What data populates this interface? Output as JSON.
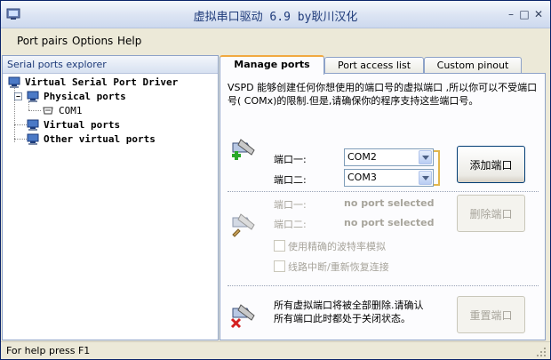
{
  "window": {
    "title": "虚拟串口驱动 6.9 by耿川汉化"
  },
  "menu": {
    "items": [
      "Port pairs",
      "Options",
      "Help"
    ]
  },
  "explorer": {
    "header": "Serial ports explorer",
    "tree": {
      "root": "Virtual Serial Port Driver",
      "physical": "Physical ports",
      "com1": "COM1",
      "virtual": "Virtual ports",
      "other": "Other virtual ports"
    }
  },
  "tabs": [
    "Manage ports",
    "Port access list",
    "Custom pinout"
  ],
  "manage": {
    "description": "VSPD 能够创建任何你想使用的端口号的虚拟端口 ,所以你可以不受端口号( COMx)的限制.但是,请确保你的程序支持这些端口号。",
    "add": {
      "port1_label": "端口一:",
      "port2_label": "端口二:",
      "port1_value": "COM2",
      "port2_value": "COM3",
      "button": "添加端口"
    },
    "remove": {
      "port1_label": "端口一:",
      "port2_label": "端口二:",
      "port1_value": "no port selected",
      "port2_value": "no port selected",
      "button": "删除端口",
      "option_baud": "使用精确的波特率模拟",
      "option_reconnect": "线路中断/重新恢复连接"
    },
    "reset": {
      "text": "所有虚拟端口将被全部删除.请确认所有端口此时都处于关闭状态。",
      "button": "重置端口"
    }
  },
  "status": {
    "text": "For help press F1"
  }
}
